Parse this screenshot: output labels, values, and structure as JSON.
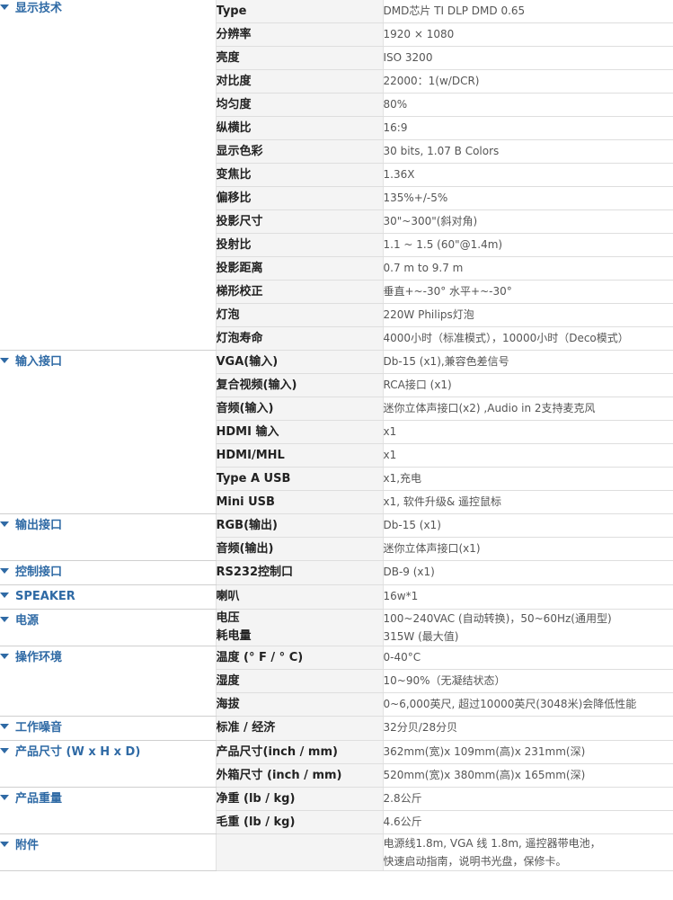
{
  "sections": [
    {
      "category": "显示技术",
      "rows": [
        {
          "spec": [
            "Type"
          ],
          "value": [
            "DMD芯片 TI DLP DMD 0.65"
          ]
        },
        {
          "spec": [
            "分辨率"
          ],
          "value": [
            "1920 × 1080"
          ]
        },
        {
          "spec": [
            "亮度"
          ],
          "value": [
            "ISO 3200"
          ]
        },
        {
          "spec": [
            "对比度"
          ],
          "value": [
            "22000：1(w/DCR)"
          ]
        },
        {
          "spec": [
            "均匀度"
          ],
          "value": [
            "80%"
          ]
        },
        {
          "spec": [
            "纵横比"
          ],
          "value": [
            "16:9"
          ]
        },
        {
          "spec": [
            "显示色彩"
          ],
          "value": [
            "30 bits, 1.07 B Colors"
          ]
        },
        {
          "spec": [
            "变焦比"
          ],
          "value": [
            "1.36X"
          ]
        },
        {
          "spec": [
            "偏移比"
          ],
          "value": [
            "135%+/-5%"
          ]
        },
        {
          "spec": [
            "投影尺寸"
          ],
          "value": [
            "30\"~300\"(斜对角)"
          ]
        },
        {
          "spec": [
            "投射比"
          ],
          "value": [
            "1.1 ~ 1.5 (60\"@1.4m)"
          ]
        },
        {
          "spec": [
            "投影距离"
          ],
          "value": [
            "0.7 m to 9.7 m"
          ]
        },
        {
          "spec": [
            "梯形校正"
          ],
          "value": [
            "垂直+~-30° 水平+~-30°"
          ]
        },
        {
          "spec": [
            "灯泡"
          ],
          "value": [
            "220W Philips灯泡"
          ]
        },
        {
          "spec": [
            "灯泡寿命"
          ],
          "value": [
            "4000小时（标准模式），10000小时（Deco模式）"
          ]
        }
      ]
    },
    {
      "category": "输入接口",
      "rows": [
        {
          "spec": [
            "VGA(输入)"
          ],
          "value": [
            "Db-15 (x1),兼容色差信号"
          ]
        },
        {
          "spec": [
            "复合视频(输入)"
          ],
          "value": [
            "RCA接口 (x1)"
          ]
        },
        {
          "spec": [
            "音频(输入)"
          ],
          "value": [
            "迷你立体声接口(x2) ,Audio in 2支持麦克风"
          ]
        },
        {
          "spec": [
            "HDMI 输入"
          ],
          "value": [
            "x1"
          ]
        },
        {
          "spec": [
            "HDMI/MHL"
          ],
          "value": [
            "x1"
          ]
        },
        {
          "spec": [
            "Type A USB"
          ],
          "value": [
            "x1,充电"
          ]
        },
        {
          "spec": [
            "Mini USB"
          ],
          "value": [
            "x1, 软件升级& 遥控鼠标"
          ]
        }
      ]
    },
    {
      "category": "输出接口",
      "rows": [
        {
          "spec": [
            "RGB(输出)"
          ],
          "value": [
            "Db-15 (x1)"
          ]
        },
        {
          "spec": [
            "音频(输出)"
          ],
          "value": [
            "迷你立体声接口(x1)"
          ]
        }
      ]
    },
    {
      "category": "控制接口",
      "rows": [
        {
          "spec": [
            "RS232控制口"
          ],
          "value": [
            "DB-9 (x1)"
          ]
        }
      ]
    },
    {
      "category": "SPEAKER",
      "rows": [
        {
          "spec": [
            "喇叭"
          ],
          "value": [
            "16w*1"
          ]
        }
      ]
    },
    {
      "category": "电源",
      "rows": [
        {
          "spec": [
            "电压",
            "耗电量"
          ],
          "value": [
            "100~240VAC (自动转换)，50~60Hz(通用型)",
            "315W (最大值)"
          ]
        }
      ]
    },
    {
      "category": "操作环境",
      "rows": [
        {
          "spec": [
            "温度 (° F / ° C)"
          ],
          "value": [
            "0-40°C"
          ]
        },
        {
          "spec": [
            "湿度"
          ],
          "value": [
            "10~90%（无凝结状态）"
          ]
        },
        {
          "spec": [
            "海拔"
          ],
          "value": [
            "0~6,000英尺, 超过10000英尺(3048米)会降低性能"
          ]
        }
      ]
    },
    {
      "category": "工作噪音",
      "rows": [
        {
          "spec": [
            "标准 / 经济"
          ],
          "value": [
            "32分贝/28分贝"
          ]
        }
      ]
    },
    {
      "category": "产品尺寸 (W x H x D)",
      "rows": [
        {
          "spec": [
            "产品尺寸(inch / mm)"
          ],
          "value": [
            "362mm(宽)x 109mm(高)x 231mm(深)"
          ]
        },
        {
          "spec": [
            "外箱尺寸 (inch / mm)"
          ],
          "value": [
            "520mm(宽)x 380mm(高)x 165mm(深)"
          ]
        }
      ]
    },
    {
      "category": "产品重量",
      "rows": [
        {
          "spec": [
            "净重 (lb / kg)"
          ],
          "value": [
            "2.8公斤"
          ]
        },
        {
          "spec": [
            "毛重 (lb / kg)"
          ],
          "value": [
            "4.6公斤"
          ]
        }
      ]
    },
    {
      "category": "附件",
      "rows": [
        {
          "spec": [
            ""
          ],
          "value": [
            "电源线1.8m, VGA 线 1.8m, 遥控器带电池，",
            "快速启动指南，说明书光盘，保修卡。"
          ]
        }
      ]
    }
  ]
}
